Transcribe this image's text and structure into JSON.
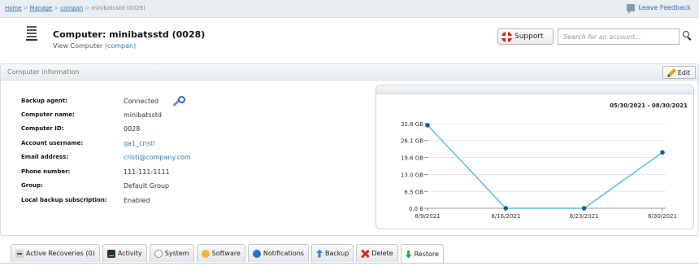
{
  "breadcrumb": {
    "items": [
      {
        "label": "Home",
        "link": true
      },
      {
        "label": "Manage",
        "link": true
      },
      {
        "label": "compan",
        "link": true
      },
      {
        "label": "minibatsstd (0028)",
        "link": false
      }
    ],
    "separator": ">"
  },
  "feedback": {
    "label": "Leave Feedback",
    "icon": "speech-bubble-icon"
  },
  "header": {
    "title": "Computer: minibatsstd (0028)",
    "subtitle_prefix": "View Computer",
    "subtitle_account": "(compan)",
    "icon": "server-icon"
  },
  "support": {
    "label": "Support",
    "icon": "lifebuoy-icon"
  },
  "search": {
    "placeholder": "Search for an account...",
    "value": "",
    "icon": "search-icon"
  },
  "panel": {
    "title": "Computer information",
    "edit_label": "Edit"
  },
  "details": [
    {
      "label": "Backup agent:",
      "value": "Connected",
      "link": false
    },
    {
      "label": "Computer name:",
      "value": "minibatsstd",
      "link": false
    },
    {
      "label": "Computer ID:",
      "value": "0028",
      "link": false
    },
    {
      "label": "Account username:",
      "value": "qa1_cristi",
      "link": true
    },
    {
      "label": "Email address:",
      "value": "cristi@company.com",
      "link": true
    },
    {
      "label": "Phone number:",
      "value": "111-111-1111",
      "link": false
    },
    {
      "label": "Group:",
      "value": "Default Group",
      "link": false
    },
    {
      "label": "Local backup subscription:",
      "value": "Enabled",
      "link": false
    }
  ],
  "chart_data": {
    "type": "line",
    "date_range": "05/30/2021 - 08/30/2021",
    "categories": [
      "8/9/2021",
      "8/16/2021",
      "8/23/2021",
      "8/30/2021"
    ],
    "values": [
      32.0,
      0.0,
      0.0,
      21.5
    ],
    "y_ticks": [
      {
        "value": 0,
        "label": "0.0 B"
      },
      {
        "value": 6.5,
        "label": "6.5 GB"
      },
      {
        "value": 13.0,
        "label": "13.0 GB"
      },
      {
        "value": 19.6,
        "label": "19.6 GB"
      },
      {
        "value": 26.1,
        "label": "26.1 GB"
      },
      {
        "value": 32.6,
        "label": "32.6 GB"
      }
    ],
    "ylim": [
      0,
      32.6
    ],
    "grid": true,
    "line_color": "#5bc0de",
    "point_color": "#1a5f84"
  },
  "tabs": [
    {
      "label": "Active Recoveries (0)",
      "icon": "recovery-icon",
      "active": false
    },
    {
      "label": "Activity",
      "icon": "activity-icon",
      "active": false
    },
    {
      "label": "System",
      "icon": "system-icon",
      "active": false
    },
    {
      "label": "Software",
      "icon": "software-icon",
      "active": false
    },
    {
      "label": "Notifications",
      "icon": "notifications-icon",
      "active": false
    },
    {
      "label": "Backup",
      "icon": "backup-icon",
      "active": false
    },
    {
      "label": "Delete",
      "icon": "delete-icon",
      "active": false
    },
    {
      "label": "Restore",
      "icon": "restore-icon",
      "active": true
    }
  ]
}
